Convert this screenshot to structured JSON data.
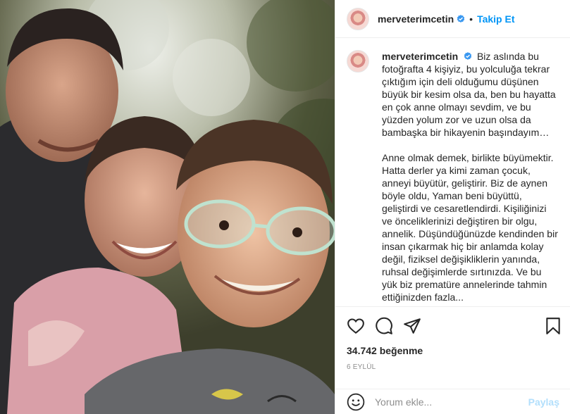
{
  "post": {
    "username": "merveterimcetin",
    "follow_label": "Takip Et",
    "separator": "•",
    "caption_paragraph_1": "Biz aslında bu fotoğrafta 4 kişiyiz, bu yolculuğa tekrar çıktığım için deli olduğumu düşünen büyük bir kesim olsa da, ben bu hayatta en çok anne olmayı sevdim, ve bu yüzden yolum zor ve uzun olsa da bambaşka bir hikayenin başındayım…",
    "caption_paragraph_2": "Anne olmak demek, birlikte büyümektir. Hatta derler ya kimi zaman çocuk, anneyi büyütür, geliştirir. Biz de aynen böyle oldu, Yaman beni büyüttü, geliştirdi ve cesaretlendirdi. Kişiliğinizi ve önceliklerinizi değiştiren bir olgu, annelik. Düşündüğünüzde kendinden bir insan çıkarmak hiç bir anlamda kolay değil, fiziksel değişikliklerin yanında, ruhsal değişimlerde sırtınızda. Ve bu yük biz prematüre annelerinde tahmin ettiğinizden fazla...",
    "likes": "34.742 beğenme",
    "date": "6 EYLÜL"
  },
  "comment": {
    "placeholder": "Yorum ekle...",
    "share_label": "Paylaş"
  },
  "icons": {
    "verified": "verified-badge-icon",
    "like": "heart-icon",
    "comment": "comment-icon",
    "share": "paper-plane-icon",
    "save": "bookmark-icon",
    "emoji": "emoji-icon"
  },
  "colors": {
    "accent": "#0095f6",
    "text": "#262626",
    "muted": "#8e8e8e",
    "share_disabled": "#b2dffc",
    "border": "#efefef"
  }
}
